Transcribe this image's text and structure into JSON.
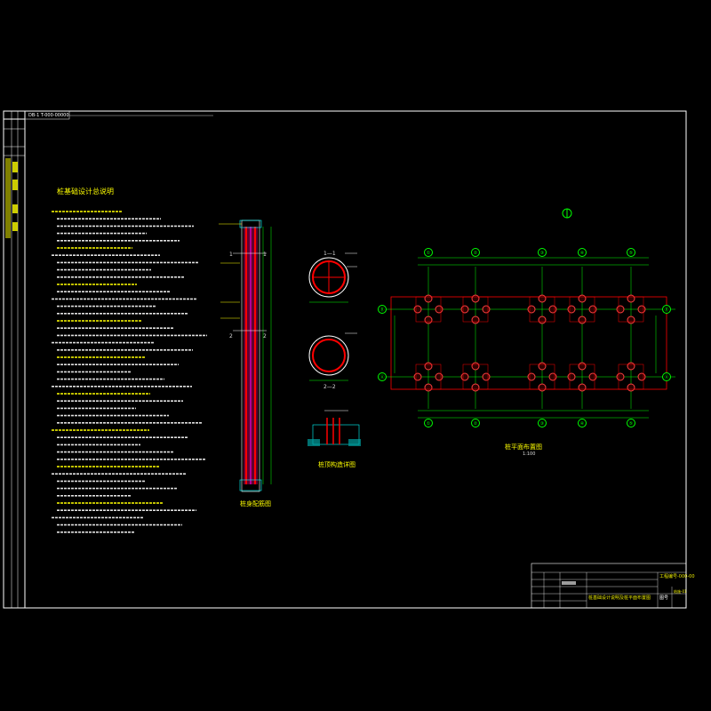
{
  "drawing": {
    "frame_code": "DB-1 T-000-00000",
    "notes_title": "桩基础设计总说明",
    "titles": {
      "pile_detail": "桩身配筋图",
      "section_1": "1—1",
      "section_2": "2—2",
      "cap_detail": "桩顶构造详图",
      "plan": "桩平面布置图",
      "plan_scale": "1:100"
    },
    "section_labels": [
      "1",
      "1",
      "2",
      "2"
    ],
    "axes_horizontal": [
      "①",
      "②",
      "③",
      "④",
      "⑤"
    ],
    "axes_vertical": [
      "Ⓑ",
      "Ⓐ"
    ],
    "title_block": {
      "project_code": "工程编号-000-00",
      "drawing_name": "桩基础设计说明及桩平面布置图",
      "sheet_label": "图号",
      "sheet_value": "结施-01"
    }
  },
  "colors": {
    "frame": "#ffffff",
    "text": "#ffff00",
    "pile": "#ff0000",
    "dim": "#00ff00",
    "axis": "#00ff00",
    "magenta": "#ff00ff",
    "cyan": "#00ffff"
  }
}
